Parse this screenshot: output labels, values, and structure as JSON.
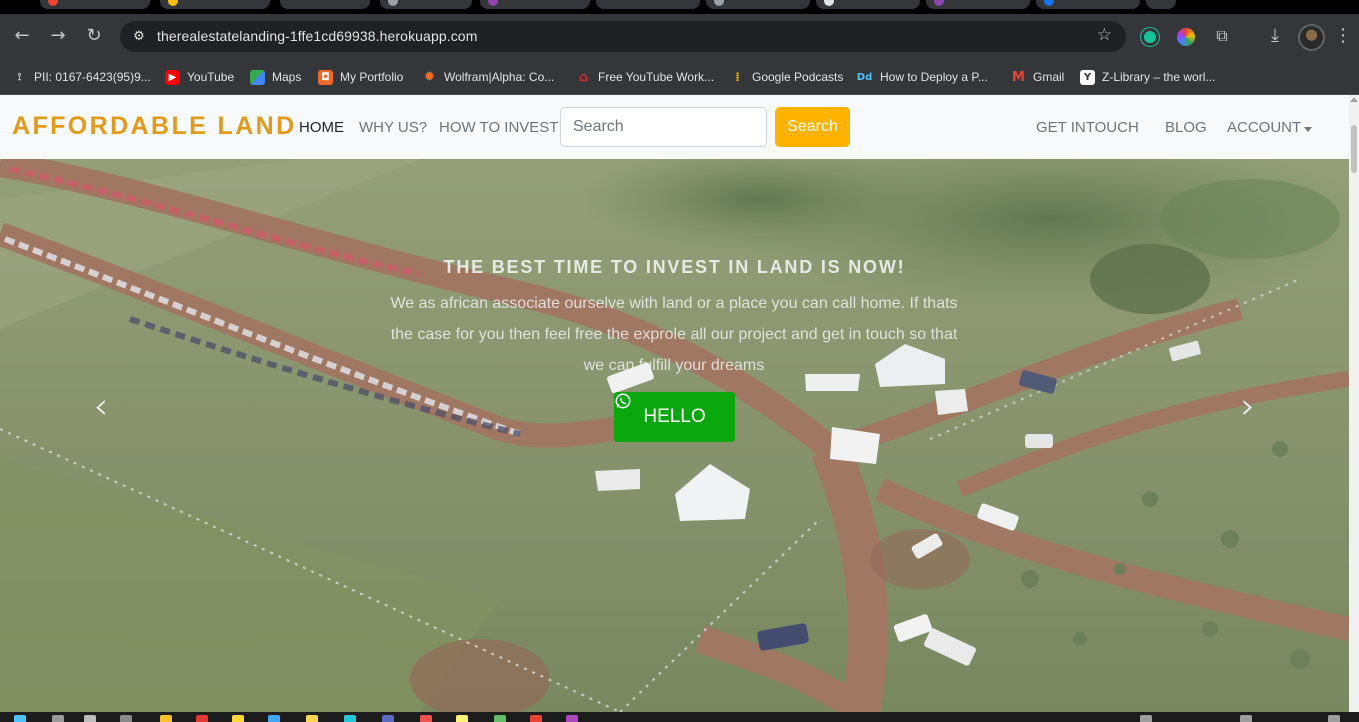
{
  "browser": {
    "url": "therealestatelanding-1ffe1cd69938.herokuapp.com",
    "bookmarks": [
      {
        "label": "PII: 0167-6423(95)9...",
        "icon": "link-icon",
        "color": "#9aa0a6"
      },
      {
        "label": "YouTube",
        "icon": "youtube-icon",
        "color": "#ff0000"
      },
      {
        "label": "Maps",
        "icon": "maps-icon",
        "color": "#34a853"
      },
      {
        "label": "My Portfolio",
        "icon": "portfolio-icon",
        "color": "#f06a26"
      },
      {
        "label": "Wolfram|Alpha: Co...",
        "icon": "wolfram-icon",
        "color": "#f96e1c"
      },
      {
        "label": "Free YouTube Work...",
        "icon": "workout-icon",
        "color": "#d32f2f"
      },
      {
        "label": "Google Podcasts",
        "icon": "podcasts-icon",
        "color": "#fbbc04"
      },
      {
        "label": "How to Deploy a P...",
        "icon": "deploy-icon",
        "color": "#4fc3f7"
      },
      {
        "label": "Gmail",
        "icon": "gmail-icon",
        "color": "#ea4335"
      },
      {
        "label": "Z-Library – the worl...",
        "icon": "zlibrary-icon",
        "color": "#ffffff"
      }
    ]
  },
  "navbar": {
    "brand": "AFFORDABLE LAND",
    "home": "HOME",
    "why_us": "WHY US?",
    "how_to_invest": "HOW TO INVEST",
    "search_placeholder": "Search",
    "search_button": "Search",
    "get_intouch": "GET INTOUCH",
    "blog": "BLOG",
    "account": "ACCOUNT"
  },
  "hero": {
    "title": "THE BEST TIME TO INVEST IN LAND IS NOW!",
    "text": "We as african associate ourselve with land or a place you can call home. If thats the case for you then feel free the exprole all our project and get in touch so that we can fulfill your dreams",
    "button": "HELLO",
    "prev_arrow": "‹",
    "next_arrow": "›"
  },
  "colors": {
    "brand": "#e09a1c",
    "search_button": "#ffb300",
    "hello_button": "#0aa80e"
  }
}
